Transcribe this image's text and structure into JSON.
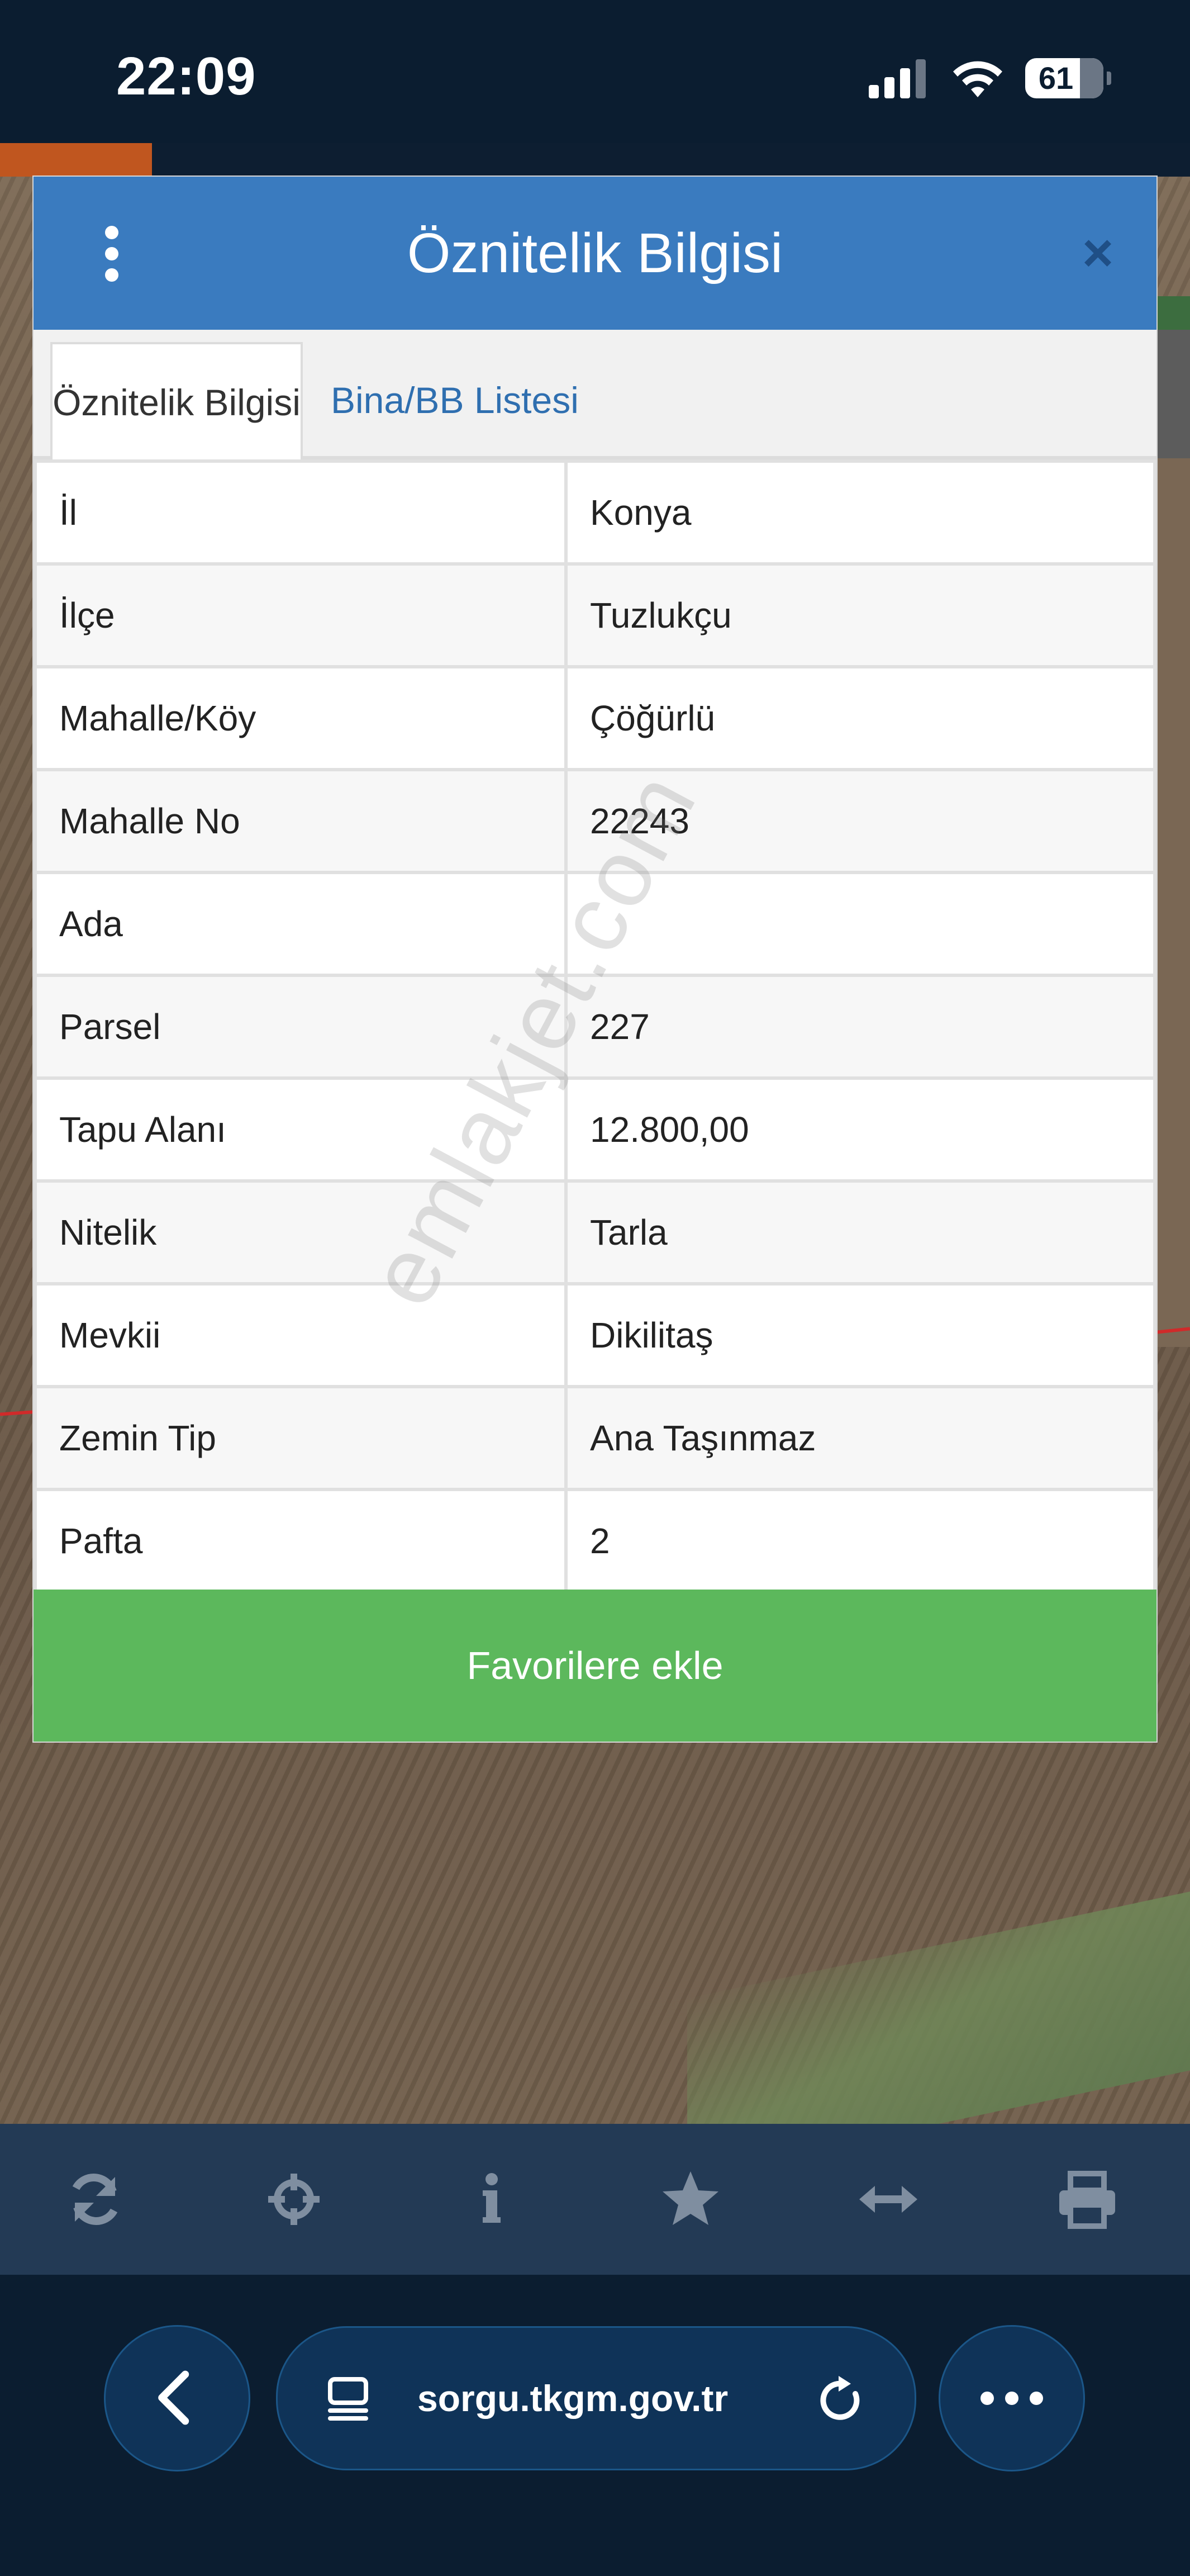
{
  "status_bar": {
    "time": "22:09",
    "battery": "61"
  },
  "dialog": {
    "title": "Öznitelik Bilgisi",
    "tabs": [
      {
        "label": "Öznitelik Bilgisi",
        "active": true
      },
      {
        "label": "Bina/BB Listesi",
        "active": false
      }
    ],
    "rows": [
      {
        "label": "İl",
        "value": "Konya"
      },
      {
        "label": "İlçe",
        "value": "Tuzlukçu"
      },
      {
        "label": "Mahalle/Köy",
        "value": "Çöğürlü"
      },
      {
        "label": "Mahalle No",
        "value": "22243"
      },
      {
        "label": "Ada",
        "value": ""
      },
      {
        "label": "Parsel",
        "value": "227"
      },
      {
        "label": "Tapu Alanı",
        "value": "12.800,00"
      },
      {
        "label": "Nitelik",
        "value": "Tarla"
      },
      {
        "label": "Mevkii",
        "value": "Dikilitaş"
      },
      {
        "label": "Zemin Tip",
        "value": "Ana Taşınmaz"
      },
      {
        "label": "Pafta",
        "value": "2"
      }
    ],
    "favorite_button": "Favorilere ekle",
    "watermark": "emlakjet.com"
  },
  "toolbar": {
    "icons": [
      "refresh-icon",
      "crosshair-icon",
      "info-icon",
      "star-icon",
      "measure-icon",
      "print-icon"
    ]
  },
  "browser": {
    "url": "sorgu.tkgm.gov.tr"
  },
  "colors": {
    "header": "#3a7bbf",
    "favorite": "#5cb85c",
    "toolbar": "#233a55",
    "browser": "#0b1d30"
  }
}
